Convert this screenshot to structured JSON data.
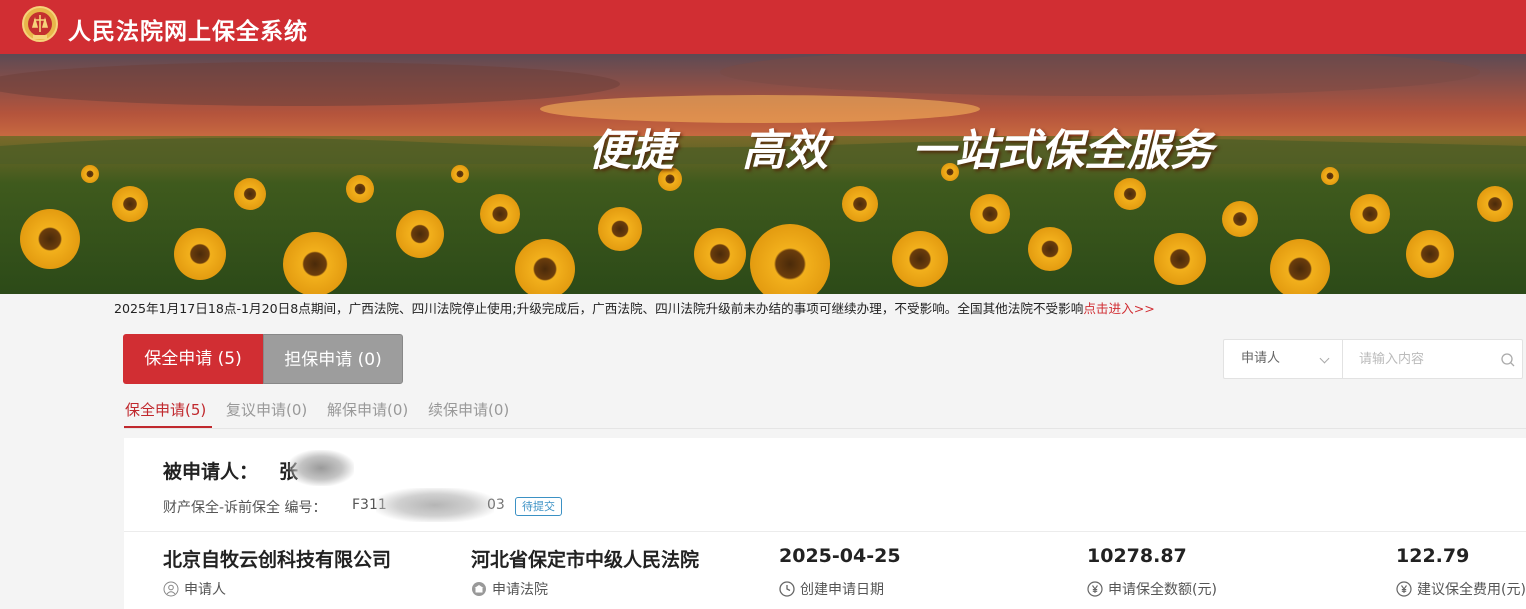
{
  "header": {
    "title": "人民法院网上保全系统",
    "color": "#d12e33"
  },
  "banner": {
    "slogan_1": "便捷",
    "slogan_2": "高效",
    "slogan_3": "一站式保全服务"
  },
  "notice": {
    "text": "2025年1月17日18点-1月20日8点期间，广西法院、四川法院停止使用;升级完成后，广西法院、四川法院升级前未办结的事项可继续办理，不受影响。全国其他法院不受影响",
    "link": "点击进入>>"
  },
  "type_tabs": [
    {
      "label": "保全申请 (5)",
      "active": true
    },
    {
      "label": "担保申请 (0)",
      "active": false
    }
  ],
  "search": {
    "select_value": "申请人",
    "placeholder": "请输入内容"
  },
  "sub_tabs": [
    {
      "label": "保全申请(5)",
      "active": true
    },
    {
      "label": "复议申请(0)",
      "active": false
    },
    {
      "label": "解保申请(0)",
      "active": false
    },
    {
      "label": "续保申请(0)",
      "active": false
    }
  ],
  "card": {
    "respondent_label": "被申请人：",
    "respondent_name": "张",
    "case_type": "财产保全-诉前保全",
    "case_no_label": "编号：",
    "case_no_prefix": "F311",
    "case_no_suffix": "03",
    "status": "待提交",
    "fields": [
      {
        "value": "北京自牧云创科技有限公司",
        "label": "申请人",
        "icon": "user-icon"
      },
      {
        "value": "河北省保定市中级人民法院",
        "label": "申请法院",
        "icon": "court-icon"
      },
      {
        "value": "2025-04-25",
        "label": "创建申请日期",
        "icon": "clock-icon"
      },
      {
        "value": "10278.87",
        "label": "申请保全数额(元)",
        "icon": "yen-icon"
      },
      {
        "value": "122.79",
        "label": "建议保全费用(元)",
        "icon": "yen-icon"
      }
    ]
  }
}
